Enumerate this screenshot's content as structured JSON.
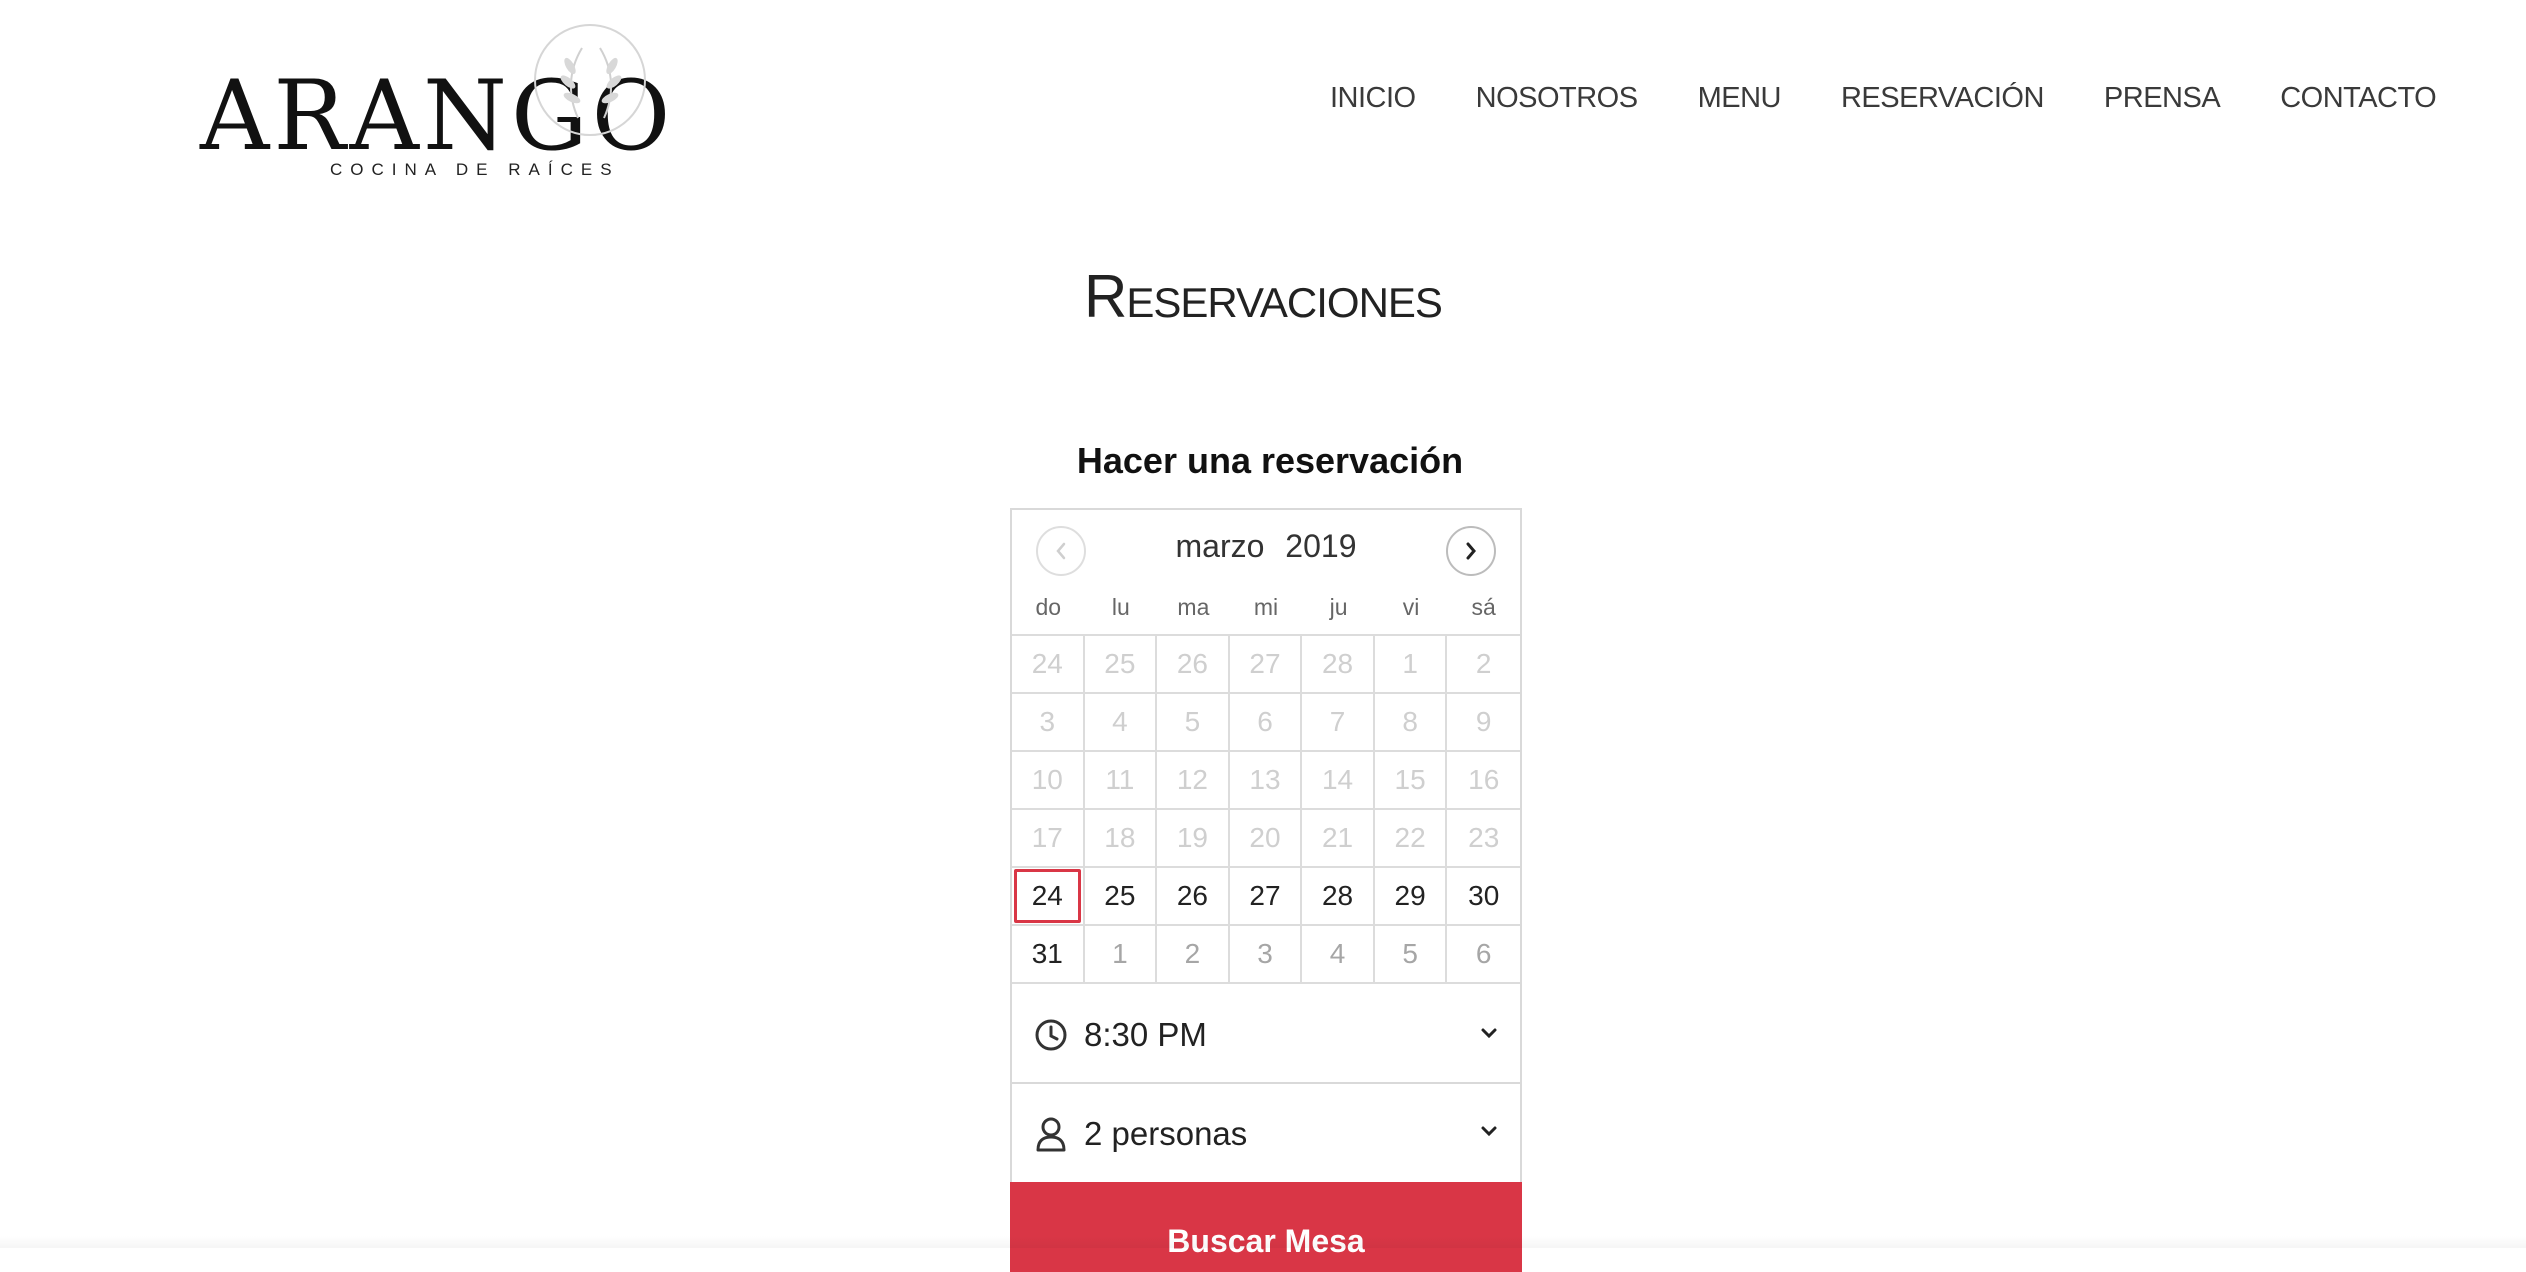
{
  "logo": {
    "name": "ARANGO",
    "tagline": "COCINA DE RAÍCES"
  },
  "nav": {
    "items": [
      {
        "label": "INICIO"
      },
      {
        "label": "NOSOTROS"
      },
      {
        "label": "MENU"
      },
      {
        "label": "RESERVACIÓN"
      },
      {
        "label": "PRENSA"
      },
      {
        "label": "CONTACTO"
      }
    ]
  },
  "page": {
    "title": "Reservaciones"
  },
  "widget": {
    "heading": "Hacer una reservación",
    "calendar": {
      "month": "marzo",
      "year": "2019",
      "prev_icon": "chevron-left-icon",
      "next_icon": "chevron-right-icon",
      "weekdays": [
        "do",
        "lu",
        "ma",
        "mi",
        "ju",
        "vi",
        "sá"
      ],
      "days": [
        "24",
        "25",
        "26",
        "27",
        "28",
        "1",
        "2",
        "3",
        "4",
        "5",
        "6",
        "7",
        "8",
        "9",
        "10",
        "11",
        "12",
        "13",
        "14",
        "15",
        "16",
        "17",
        "18",
        "19",
        "20",
        "21",
        "22",
        "23",
        "24",
        "25",
        "26",
        "27",
        "28",
        "29",
        "30",
        "31",
        "1",
        "2",
        "3",
        "4",
        "5",
        "6"
      ],
      "selected_day": "24"
    },
    "time": {
      "value": "8:30 PM",
      "icon": "clock-icon"
    },
    "party": {
      "value": "2 personas",
      "icon": "person-icon"
    },
    "search_button": "Buscar Mesa",
    "colors": {
      "accent": "#d93646"
    }
  }
}
